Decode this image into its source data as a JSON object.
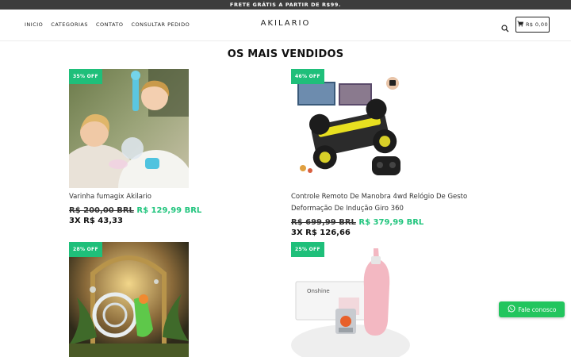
{
  "topbar": {
    "text": "FRETE GRÁTIS A PARTIR DE R$99."
  },
  "header": {
    "nav": [
      "INICIO",
      "CATEGORIAS",
      "CONTATO",
      "CONSULTAR PEDIDO"
    ],
    "logo": "AKILARIO",
    "cart_total": "R$ 0,00"
  },
  "section": {
    "title": "OS MAIS VENDIDOS"
  },
  "products": [
    {
      "badge": "35% OFF",
      "name": "Varinha fumagix Akilario",
      "old_price": "R$ 200,00 BRL",
      "new_price": "R$ 129,99 BRL",
      "installments": "3X R$ 43,33"
    },
    {
      "badge": "46% OFF",
      "name": "Controle Remoto De Manobra 4wd Relógio De Gesto Deformação De Indução Giro 360",
      "old_price": "R$ 699,99 BRL",
      "new_price": "R$ 379,99 BRL",
      "installments": "3X R$ 126,66"
    },
    {
      "badge": "28% OFF"
    },
    {
      "badge": "25% OFF",
      "box_text": "Onshine"
    }
  ],
  "whatsapp": {
    "label": "Fale conosco"
  },
  "colors": {
    "accent_green": "#1fbf7a",
    "topbar": "#3d3d3d",
    "whatsapp": "#22c55e"
  },
  "icons": [
    "search-icon",
    "cart-icon",
    "whatsapp-icon"
  ]
}
